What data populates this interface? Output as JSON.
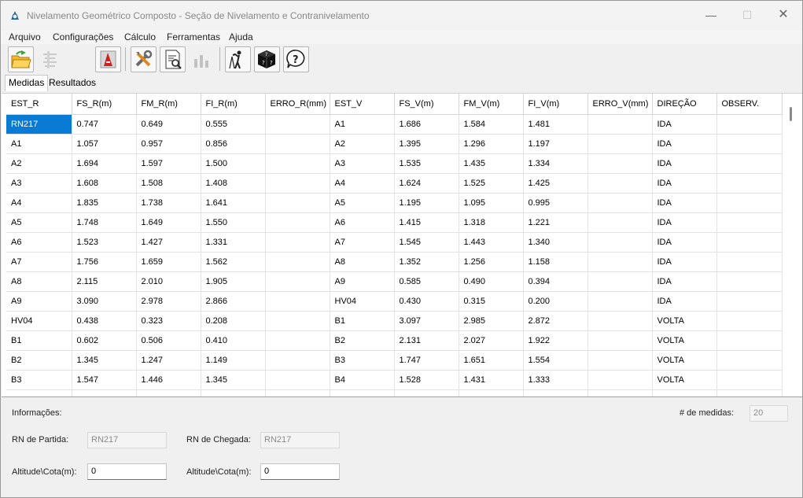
{
  "window": {
    "title": "Nivelamento Geométrico Composto - Seção de Nivelamento e Contranivelamento",
    "minimize_glyph": "—",
    "maximize_glyph": "☐",
    "close_glyph": "✕"
  },
  "menu": [
    "Arquivo",
    "Configurações",
    "Cálculo",
    "Ferramentas",
    "Ajuda"
  ],
  "toolbar": {
    "icons": [
      "open-folder-icon",
      "align-icon",
      "blank-icon",
      "autocad-icon",
      "tools-icon",
      "report-icon",
      "chart-icon",
      "surveyor-icon",
      "dice-icon",
      "help-icon"
    ]
  },
  "tabs": [
    "Medidas",
    "Resultados"
  ],
  "grid": {
    "columns": [
      "EST_R",
      "FS_R(m)",
      "FM_R(m)",
      "FI_R(m)",
      "ERRO_R(mm)",
      "EST_V",
      "FS_V(m)",
      "FM_V(m)",
      "FI_V(m)",
      "ERRO_V(mm)",
      "DIREÇÃO",
      "OBSERV."
    ],
    "rows": [
      [
        "RN217",
        "0.747",
        "0.649",
        "0.555",
        "",
        "A1",
        "1.686",
        "1.584",
        "1.481",
        "",
        "IDA",
        ""
      ],
      [
        "A1",
        "1.057",
        "0.957",
        "0.856",
        "",
        "A2",
        "1.395",
        "1.296",
        "1.197",
        "",
        "IDA",
        ""
      ],
      [
        "A2",
        "1.694",
        "1.597",
        "1.500",
        "",
        "A3",
        "1.535",
        "1.435",
        "1.334",
        "",
        "IDA",
        ""
      ],
      [
        "A3",
        "1.608",
        "1.508",
        "1.408",
        "",
        "A4",
        "1.624",
        "1.525",
        "1.425",
        "",
        "IDA",
        ""
      ],
      [
        "A4",
        "1.835",
        "1.738",
        "1.641",
        "",
        "A5",
        "1.195",
        "1.095",
        "0.995",
        "",
        "IDA",
        ""
      ],
      [
        "A5",
        "1.748",
        "1.649",
        "1.550",
        "",
        "A6",
        "1.415",
        "1.318",
        "1.221",
        "",
        "IDA",
        ""
      ],
      [
        "A6",
        "1.523",
        "1.427",
        "1.331",
        "",
        "A7",
        "1.545",
        "1.443",
        "1.340",
        "",
        "IDA",
        ""
      ],
      [
        "A7",
        "1.756",
        "1.659",
        "1.562",
        "",
        "A8",
        "1.352",
        "1.256",
        "1.158",
        "",
        "IDA",
        ""
      ],
      [
        "A8",
        "2.115",
        "2.010",
        "1.905",
        "",
        "A9",
        "0.585",
        "0.490",
        "0.394",
        "",
        "IDA",
        ""
      ],
      [
        "A9",
        "3.090",
        "2.978",
        "2.866",
        "",
        "HV04",
        "0.430",
        "0.315",
        "0.200",
        "",
        "IDA",
        ""
      ],
      [
        "HV04",
        "0.438",
        "0.323",
        "0.208",
        "",
        "B1",
        "3.097",
        "2.985",
        "2.872",
        "",
        "VOLTA",
        ""
      ],
      [
        "B1",
        "0.602",
        "0.506",
        "0.410",
        "",
        "B2",
        "2.131",
        "2.027",
        "1.922",
        "",
        "VOLTA",
        ""
      ],
      [
        "B2",
        "1.345",
        "1.247",
        "1.149",
        "",
        "B3",
        "1.747",
        "1.651",
        "1.554",
        "",
        "VOLTA",
        ""
      ],
      [
        "B3",
        "1.547",
        "1.446",
        "1.345",
        "",
        "B4",
        "1.528",
        "1.431",
        "1.333",
        "",
        "VOLTA",
        ""
      ],
      [
        "",
        "",
        "",
        "",
        "",
        "",
        "",
        "",
        "",
        "",
        "",
        ""
      ]
    ]
  },
  "info": {
    "heading": "Informações:",
    "count_label": "# de medidas:",
    "count_value": "20",
    "rn_start_label": "RN de Partida:",
    "rn_start_value": "RN217",
    "rn_end_label": "RN de Chegada:",
    "rn_end_value": "RN217",
    "alt_start_label": "Altitude\\Cota(m):",
    "alt_start_value": "0",
    "alt_end_label": "Altitude\\Cota(m):",
    "alt_end_value": "0"
  }
}
